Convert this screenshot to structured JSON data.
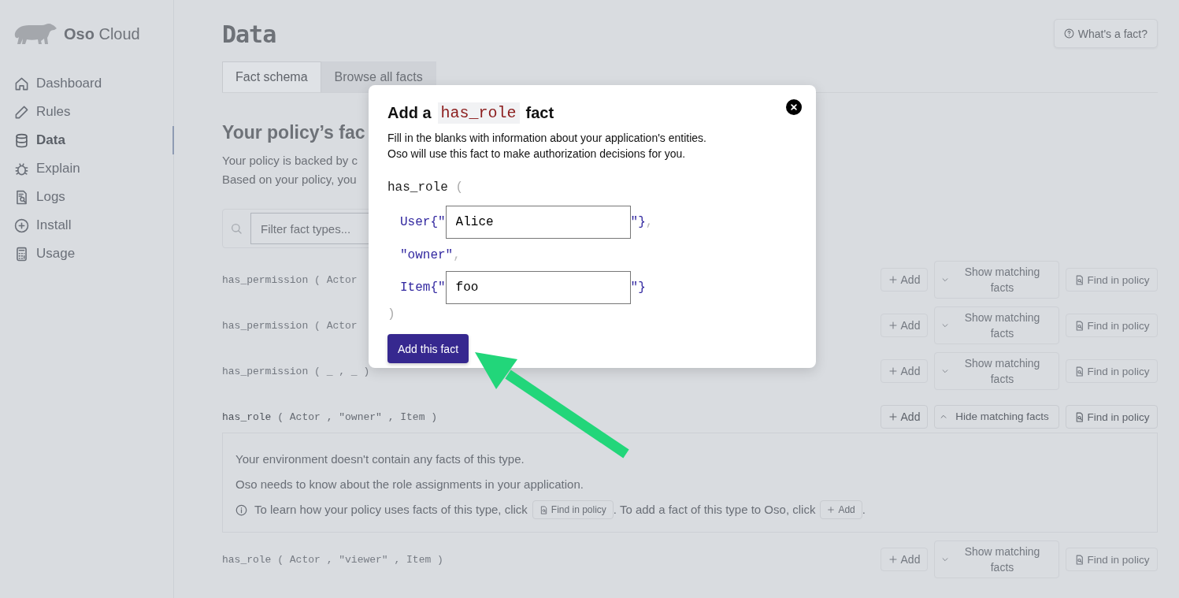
{
  "sidebar": {
    "logo": "**Oso** Cloud",
    "items": [
      {
        "label": "Dashboard",
        "selected": false
      },
      {
        "label": "Rules",
        "selected": false
      },
      {
        "label": "Data",
        "selected": true
      },
      {
        "label": "Explain",
        "selected": false
      },
      {
        "label": "Logs",
        "selected": false
      },
      {
        "label": "Install",
        "selected": false
      },
      {
        "label": "Usage",
        "selected": false
      }
    ]
  },
  "header": {
    "title": "Data",
    "help_button": "What's a fact?"
  },
  "tabs": [
    {
      "label": "Fact schema",
      "selected": true
    },
    {
      "label": "Browse all facts",
      "selected": false
    }
  ],
  "section": {
    "heading": "Your policy’s fac",
    "description": [
      "Your policy is backed by c",
      "Based on your policy, you"
    ]
  },
  "search": {
    "placeholder": "Filter fact types..."
  },
  "facts": [
    {
      "name": "has_permission",
      "params": "( Actor",
      "expanded": false,
      "add": "Add",
      "toggle": "Show matching facts",
      "find": "Find in policy"
    },
    {
      "name": "has_permission",
      "params": "( Actor",
      "expanded": false,
      "add": "Add",
      "toggle": "Show matching facts",
      "find": "Find in policy"
    },
    {
      "name": "has_permission",
      "params": "( _ , _ )",
      "expanded": false,
      "add": "Add",
      "toggle": "Show matching facts",
      "find": "Find in policy"
    },
    {
      "name": "has_role",
      "params": "( Actor , \"owner\" , Item )",
      "expanded": true,
      "add": "Add",
      "toggle": "Hide matching facts",
      "find": "Find in policy",
      "details": {
        "lines": [
          "Your environment doesn't contain any facts of this type.",
          "Oso needs to know about the role assignments in your application."
        ],
        "hint": {
          "before": "To learn how your policy uses facts of this type, click",
          "find": "Find in policy",
          "middle": ". To add a fact of this type to Oso, click",
          "add": "Add",
          "after": "."
        }
      }
    },
    {
      "name": "has_role",
      "params": "( Actor , \"viewer\" , Item )",
      "expanded": false,
      "add": "Add",
      "toggle": "Show matching facts",
      "find": "Find in policy"
    }
  ],
  "modal": {
    "title_prefix": "Add a",
    "title_code": "has_role",
    "title_suffix": "fact",
    "description": [
      "Fill in the blanks with information about your application's entities.",
      "Oso will use this fact to make authorization decisions for you."
    ],
    "predicate": "has_role",
    "open": "(",
    "args": [
      {
        "kind": "input",
        "prefix": "User{\"",
        "value": "Alice",
        "suffix": "\"}",
        "separator": ","
      },
      {
        "kind": "literal",
        "text": "\"owner\"",
        "separator": ","
      },
      {
        "kind": "input",
        "prefix": "Item{\"",
        "value": "foo",
        "suffix": "\"}"
      }
    ],
    "close": ")",
    "submit": "Add this fact"
  }
}
